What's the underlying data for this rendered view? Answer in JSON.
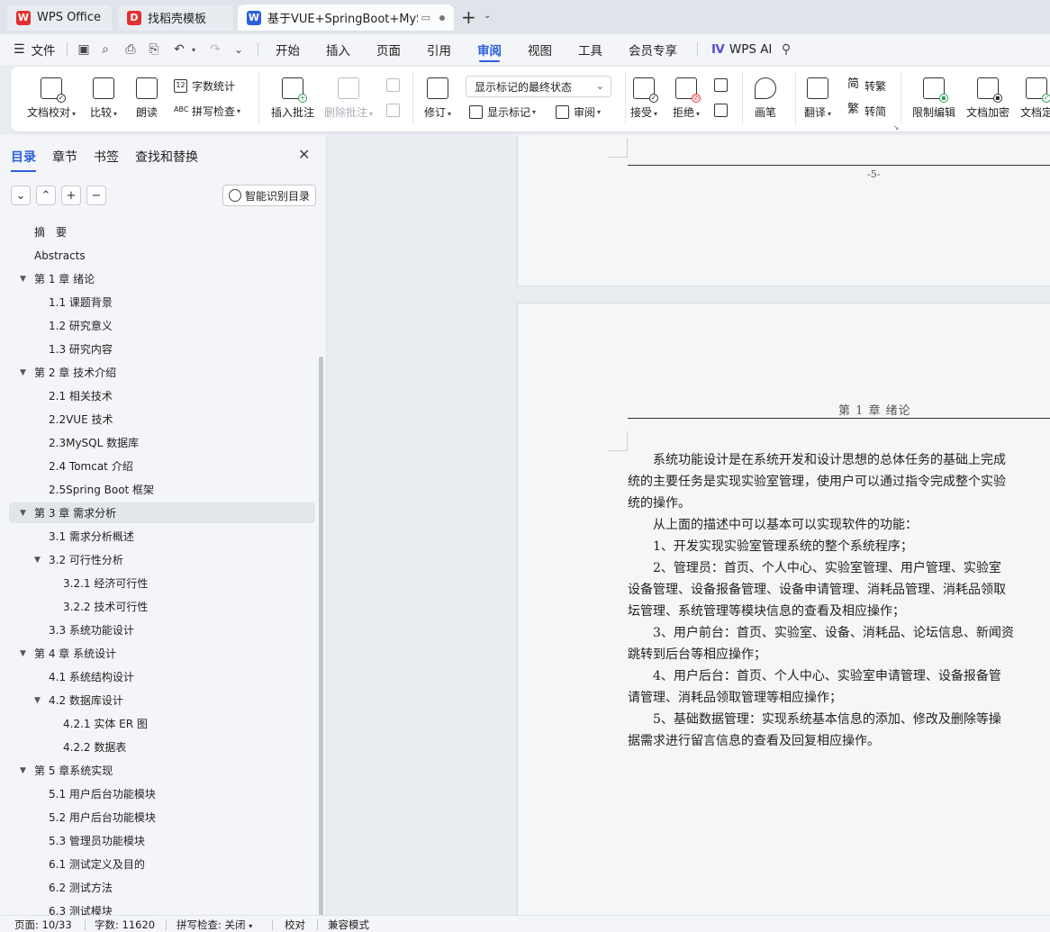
{
  "tabs": [
    {
      "label": "WPS Office",
      "icon": "wps-logo-icon",
      "color": "#e0312e"
    },
    {
      "label": "找稻壳模板",
      "icon": "docer-icon",
      "color": "#e0312e"
    },
    {
      "label": "基于VUE+SpringBoot+MySQ",
      "icon": "word-doc-icon",
      "color": "#2c5fdb"
    }
  ],
  "menu": {
    "file": "文件",
    "items": [
      "开始",
      "插入",
      "页面",
      "引用",
      "审阅",
      "视图",
      "工具",
      "会员专享"
    ],
    "active": "审阅",
    "wps_ai": "WPS AI"
  },
  "ribbon": {
    "doc_proofread": "文档校对",
    "compare": "比较",
    "read_aloud": "朗读",
    "word_count": "字数统计",
    "spell_check": "拼写检查",
    "insert_comment": "插入批注",
    "delete_comment": "删除批注",
    "track_changes": "修订",
    "markup_state": "显示标记的最终状态",
    "show_markup": "显示标记",
    "review": "审阅",
    "accept": "接受",
    "reject": "拒绝",
    "pen": "画笔",
    "translate": "翻译",
    "to_traditional": "转繁",
    "to_simplified": "转简",
    "restrict_edit": "限制编辑",
    "encrypt": "文档加密",
    "finalize": "文档定"
  },
  "nav": {
    "tabs": [
      "目录",
      "章节",
      "书签",
      "查找和替换"
    ],
    "active_tab": "目录",
    "smart_toc": "智能识别目录",
    "toc": [
      {
        "text": "摘　要",
        "level": 1,
        "arrow": false
      },
      {
        "text": "Abstracts",
        "level": 1,
        "arrow": false
      },
      {
        "text": "第 1 章  绪论",
        "level": 1,
        "arrow": true
      },
      {
        "text": "1.1 课题背景",
        "level": 2,
        "arrow": false
      },
      {
        "text": "1.2 研究意义",
        "level": 2,
        "arrow": false
      },
      {
        "text": "1.3 研究内容",
        "level": 2,
        "arrow": false
      },
      {
        "text": "第 2 章  技术介绍",
        "level": 1,
        "arrow": true
      },
      {
        "text": "2.1 相关技术",
        "level": 2,
        "arrow": false
      },
      {
        "text": "2.2VUE 技术",
        "level": 2,
        "arrow": false
      },
      {
        "text": "2.3MySQL 数据库",
        "level": 2,
        "arrow": false
      },
      {
        "text": "2.4 Tomcat 介绍",
        "level": 2,
        "arrow": false
      },
      {
        "text": "2.5Spring Boot 框架",
        "level": 2,
        "arrow": false
      },
      {
        "text": "第 3 章  需求分析",
        "level": 1,
        "arrow": true,
        "selected": true
      },
      {
        "text": "3.1 需求分析概述",
        "level": 2,
        "arrow": false
      },
      {
        "text": "3.2 可行性分析",
        "level": 2,
        "arrow": true
      },
      {
        "text": "3.2.1 经济可行性",
        "level": 3,
        "arrow": false
      },
      {
        "text": "3.2.2 技术可行性",
        "level": 3,
        "arrow": false
      },
      {
        "text": "3.3 系统功能设计",
        "level": 2,
        "arrow": false
      },
      {
        "text": "第 4 章  系统设计",
        "level": 1,
        "arrow": true
      },
      {
        "text": "4.1 系统结构设计",
        "level": 2,
        "arrow": false
      },
      {
        "text": "4.2 数据库设计",
        "level": 2,
        "arrow": true
      },
      {
        "text": "4.2.1 实体 ER 图",
        "level": 3,
        "arrow": false
      },
      {
        "text": "4.2.2 数据表",
        "level": 3,
        "arrow": false
      },
      {
        "text": "第 5 章系统实现",
        "level": 1,
        "arrow": true
      },
      {
        "text": "5.1 用户后台功能模块",
        "level": 2,
        "arrow": false
      },
      {
        "text": "5.2 用户后台功能模块",
        "level": 2,
        "arrow": false
      },
      {
        "text": "5.3 管理员功能模块",
        "level": 2,
        "arrow": false
      },
      {
        "text": "6.1 测试定义及目的",
        "level": 2,
        "arrow": false
      },
      {
        "text": "6.2 测试方法",
        "level": 2,
        "arrow": false
      },
      {
        "text": "6.3 测试模块",
        "level": 2,
        "arrow": false
      }
    ]
  },
  "document": {
    "page_number": "-5-",
    "running_header": "第 1 章  绪论",
    "paragraphs": [
      "　　系统功能设计是在系统开发和设计思想的总体任务的基础上完成",
      "统的主要任务是实现实验室管理，使用户可以通过指令完成整个实验",
      "统的操作。",
      "　　从上面的描述中可以基本可以实现软件的功能：",
      "　　1、开发实现实验室管理系统的整个系统程序；",
      "　　2、管理员：首页、个人中心、实验室管理、用户管理、实验室",
      "设备管理、设备报备管理、设备申请管理、消耗品管理、消耗品领取",
      "坛管理、系统管理等模块信息的查看及相应操作；",
      "　　3、用户前台：首页、实验室、设备、消耗品、论坛信息、新闻资",
      "跳转到后台等相应操作；",
      "　　4、用户后台：首页、个人中心、实验室申请管理、设备报备管",
      "请管理、消耗品领取管理等相应操作；",
      "　　5、基础数据管理：实现系统基本信息的添加、修改及删除等操",
      "据需求进行留言信息的查看及回复相应操作。"
    ]
  },
  "status": {
    "page": "页面: 10/33",
    "words": "字数: 11620",
    "spell": "拼写检查: 关闭",
    "proof": "校对",
    "compat": "兼容模式"
  },
  "colors": {
    "accent": "#2c5fdb",
    "wps_red": "#e0312e"
  }
}
